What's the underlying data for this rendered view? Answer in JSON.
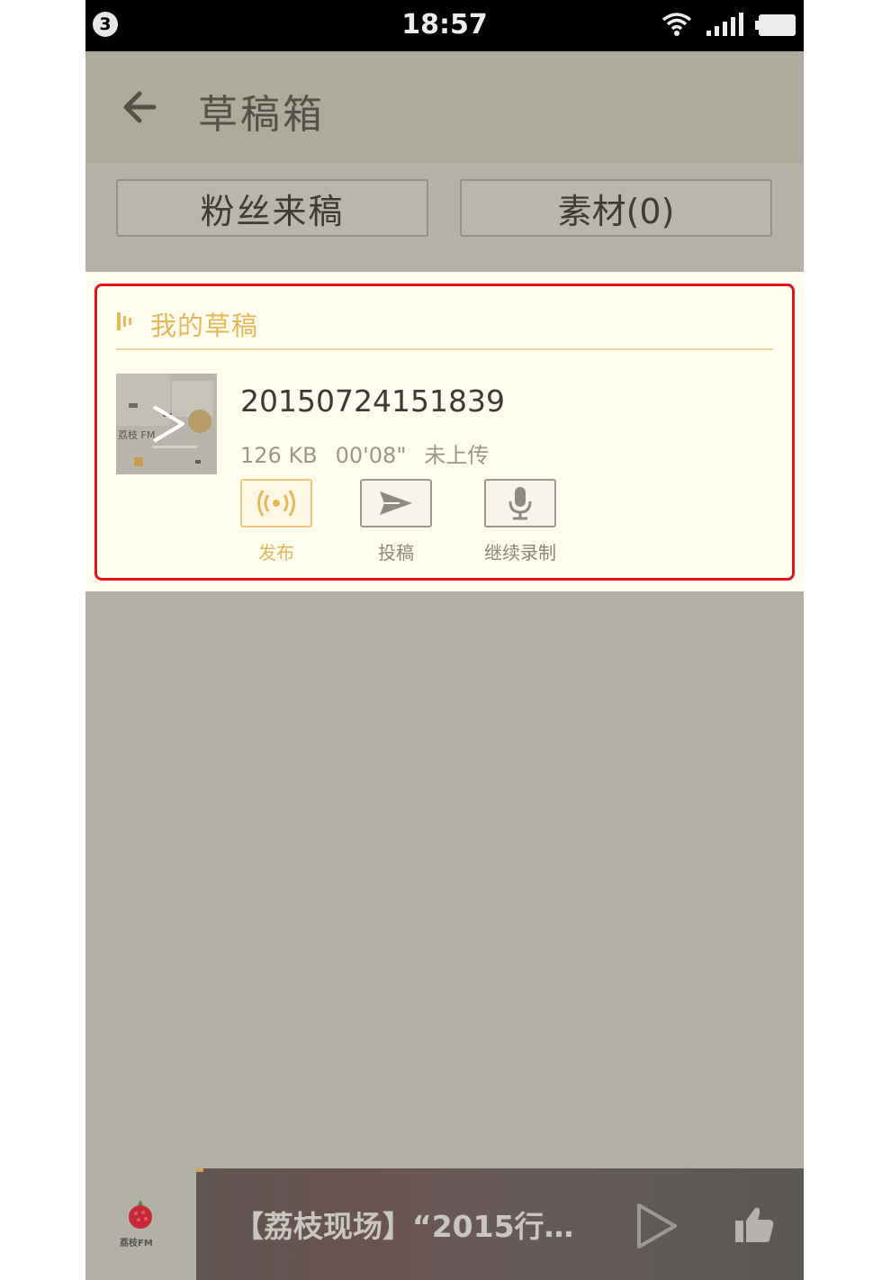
{
  "status_bar": {
    "notification_count": "3",
    "time": "18:57"
  },
  "header": {
    "title": "草稿箱",
    "back_icon": "back-arrow-icon"
  },
  "tabs": [
    {
      "label": "粉丝来稿"
    },
    {
      "label": "素材(0)"
    }
  ],
  "section": {
    "title": "我的草稿"
  },
  "draft": {
    "name": "20150724151839",
    "size": "126 KB",
    "duration": "00'08\"",
    "status": "未上传",
    "thumb_text": "荔枝 FM",
    "actions": [
      {
        "label": "发布",
        "icon": "broadcast-icon"
      },
      {
        "label": "投稿",
        "icon": "send-icon"
      },
      {
        "label": "继续录制",
        "icon": "microphone-icon"
      }
    ]
  },
  "player": {
    "logo_text": "荔枝FM",
    "now_playing": "【荔枝现场】“2015行…"
  },
  "colors": {
    "accent": "#e6b85a",
    "highlight_border": "#e0161b",
    "overlay": "#b2afa6"
  }
}
